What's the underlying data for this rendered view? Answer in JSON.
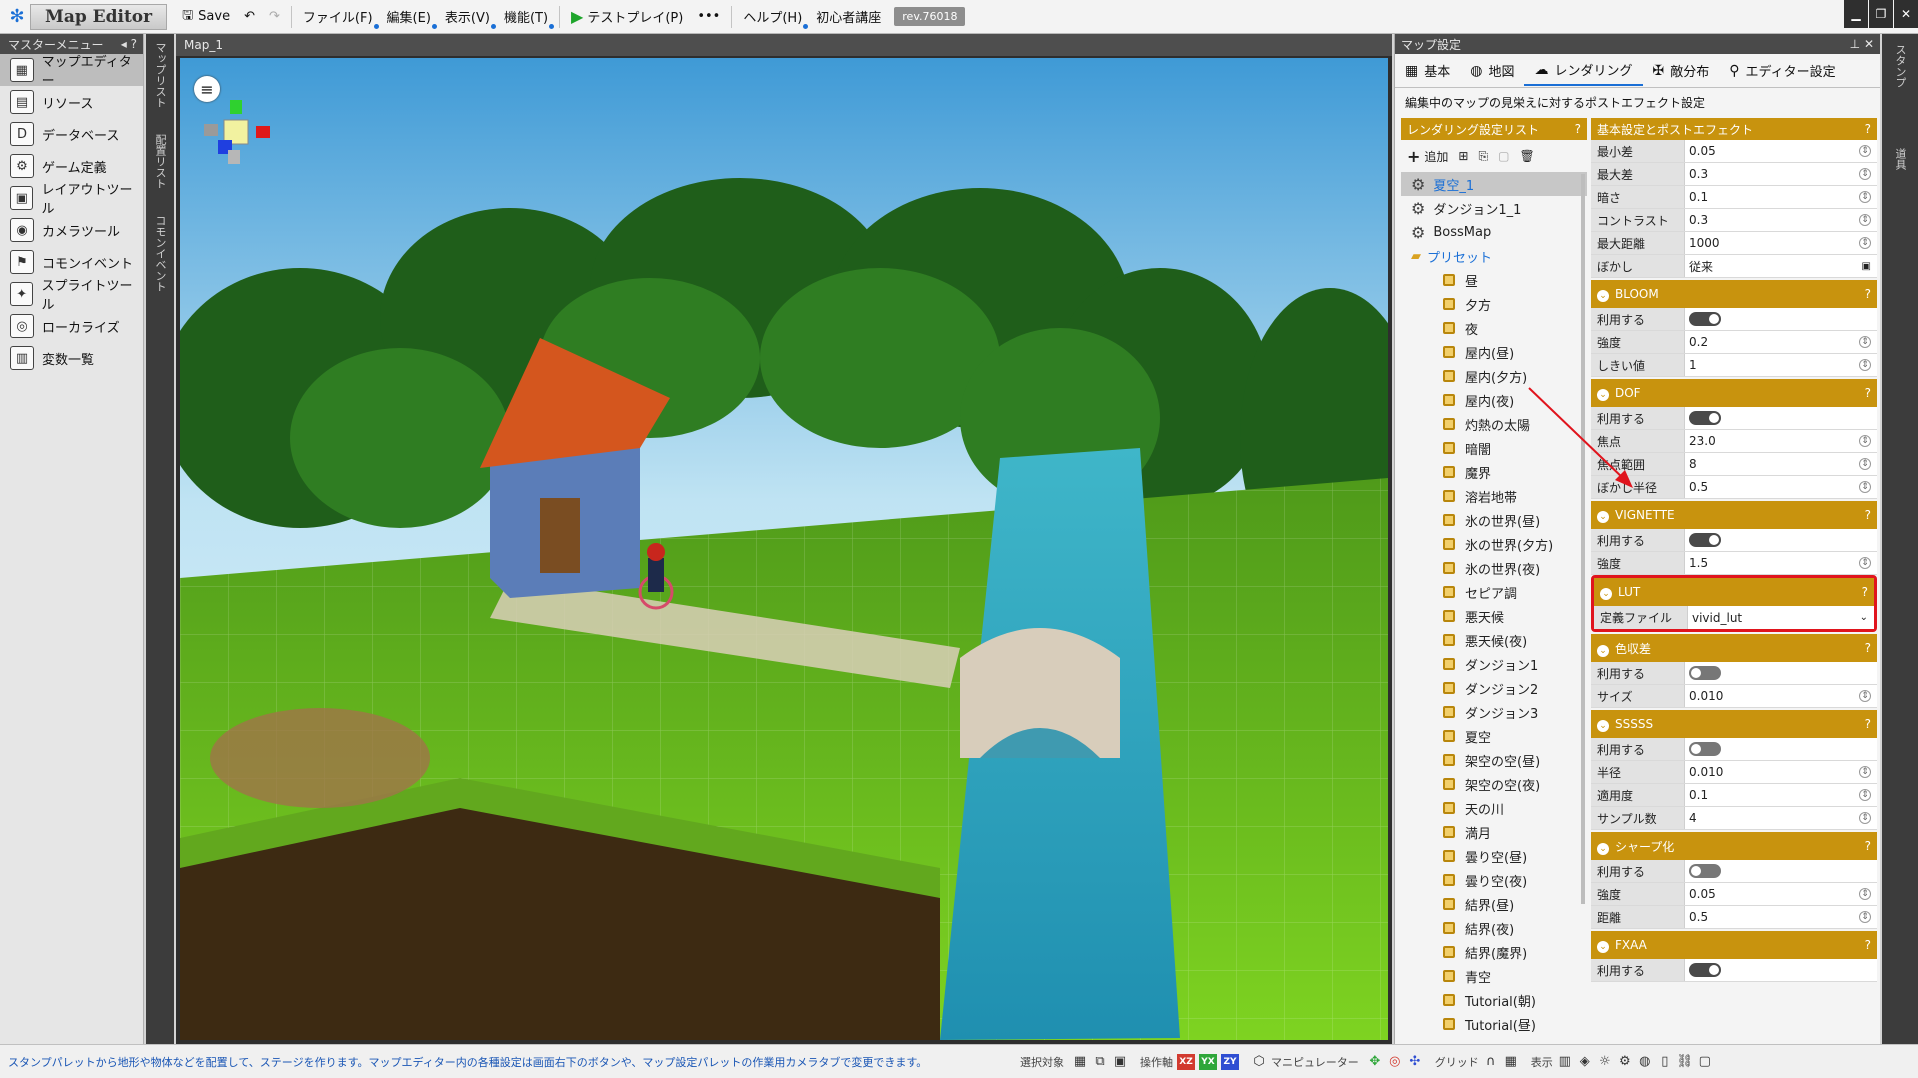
{
  "app": {
    "title": "Map Editor",
    "save_label": "Save",
    "menus": [
      "ファイル(F)",
      "編集(E)",
      "表示(V)",
      "機能(T)"
    ],
    "testplay_label": "テストプレイ(P)",
    "more_label": "•••",
    "help_label": "ヘルプ(H)",
    "tutorial_label": "初心者講座",
    "revision": "rev.76018"
  },
  "left_menu": {
    "header": "マスターメニュー",
    "items": [
      {
        "label": "マップエディター",
        "icon": "▦"
      },
      {
        "label": "リソース",
        "icon": "▤"
      },
      {
        "label": "データベース",
        "icon": "D"
      },
      {
        "label": "ゲーム定義",
        "icon": "⚙"
      },
      {
        "label": "レイアウトツール",
        "icon": "▣"
      },
      {
        "label": "カメラツール",
        "icon": "◉"
      },
      {
        "label": "コモンイベント",
        "icon": "⚑"
      },
      {
        "label": "スプライトツール",
        "icon": "✦"
      },
      {
        "label": "ローカライズ",
        "icon": "◎"
      },
      {
        "label": "変数一覧",
        "icon": "▥"
      }
    ]
  },
  "vstrip": {
    "tabs": [
      "マップリスト",
      "配置リスト",
      "コモンイベント"
    ]
  },
  "rstrip": {
    "tabs": [
      "スタンプ",
      "道具"
    ]
  },
  "map": {
    "tab": "Map_1"
  },
  "settings": {
    "header": "マップ設定",
    "tabs": [
      {
        "label": "基本",
        "icon": "▦"
      },
      {
        "label": "地図",
        "icon": "◍"
      },
      {
        "label": "レンダリング",
        "icon": "☁"
      },
      {
        "label": "敵分布",
        "icon": "✠"
      },
      {
        "label": "エディター設定",
        "icon": "⚲"
      }
    ],
    "description": "編集中のマップの見栄えに対するポストエフェクト設定",
    "list_header": "レンダリング設定リスト",
    "list_add": "追加",
    "list_items": [
      "夏空_1",
      "ダンジョン1_1",
      "BossMap"
    ],
    "preset_folder": "プリセット",
    "presets": [
      "昼",
      "夕方",
      "夜",
      "屋内(昼)",
      "屋内(夕方)",
      "屋内(夜)",
      "灼熱の太陽",
      "暗闇",
      "魔界",
      "溶岩地帯",
      "氷の世界(昼)",
      "氷の世界(夕方)",
      "氷の世界(夜)",
      "セピア調",
      "悪天候",
      "悪天候(夜)",
      "ダンジョン1",
      "ダンジョン2",
      "ダンジョン3",
      "夏空",
      "架空の空(昼)",
      "架空の空(夜)",
      "天の川",
      "満月",
      "曇り空(昼)",
      "曇り空(夜)",
      "結界(昼)",
      "結界(夜)",
      "結界(魔界)",
      "青空",
      "Tutorial(朝)",
      "Tutorial(昼)"
    ],
    "prop_header": "基本設定とポストエフェクト",
    "basic": [
      {
        "k": "最小差",
        "v": "0.05"
      },
      {
        "k": "最大差",
        "v": "0.3"
      },
      {
        "k": "暗さ",
        "v": "0.1"
      },
      {
        "k": "コントラスト",
        "v": "0.3"
      },
      {
        "k": "最大距離",
        "v": "1000"
      },
      {
        "k": "ぼかし",
        "v": "従来"
      }
    ],
    "use_label": "利用する",
    "bloom": {
      "title": "BLOOM",
      "rows": [
        {
          "k": "強度",
          "v": "0.2"
        },
        {
          "k": "しきい値",
          "v": "1"
        }
      ]
    },
    "dof": {
      "title": "DOF",
      "rows": [
        {
          "k": "焦点",
          "v": "23.0"
        },
        {
          "k": "焦点範囲",
          "v": "8"
        },
        {
          "k": "ぼかし半径",
          "v": "0.5"
        }
      ]
    },
    "vignette": {
      "title": "VIGNETTE",
      "rows": [
        {
          "k": "強度",
          "v": "1.5"
        }
      ]
    },
    "lut": {
      "title": "LUT",
      "file_label": "定義ファイル",
      "file_value": "vivid_lut"
    },
    "chroma": {
      "title": "色収差",
      "rows": [
        {
          "k": "サイズ",
          "v": "0.010"
        }
      ]
    },
    "sssss": {
      "title": "SSSSS",
      "rows": [
        {
          "k": "半径",
          "v": "0.010"
        },
        {
          "k": "適用度",
          "v": "0.1"
        },
        {
          "k": "サンプル数",
          "v": "4"
        }
      ]
    },
    "sharpen": {
      "title": "シャープ化",
      "rows": [
        {
          "k": "強度",
          "v": "0.05"
        },
        {
          "k": "距離",
          "v": "0.5"
        }
      ]
    },
    "fxaa": {
      "title": "FXAA"
    }
  },
  "status": {
    "message": "スタンプパレットから地形や物体などを配置して、ステージを作ります。マップエディター内の各種設定は画面右下のボタンや、マップ設定パレットの作業用カメラタブで変更できます。",
    "target_label": "選択対象",
    "ops_label": "操作軸",
    "axes": [
      "XZ",
      "YX",
      "ZY"
    ],
    "manip_label": "マニピュレーター",
    "grid_label": "グリッド",
    "view_label": "表示"
  },
  "colors": {
    "accent": "#1a6fd6",
    "section_gold": "#c8930e",
    "highlight_red": "#e0141d"
  }
}
